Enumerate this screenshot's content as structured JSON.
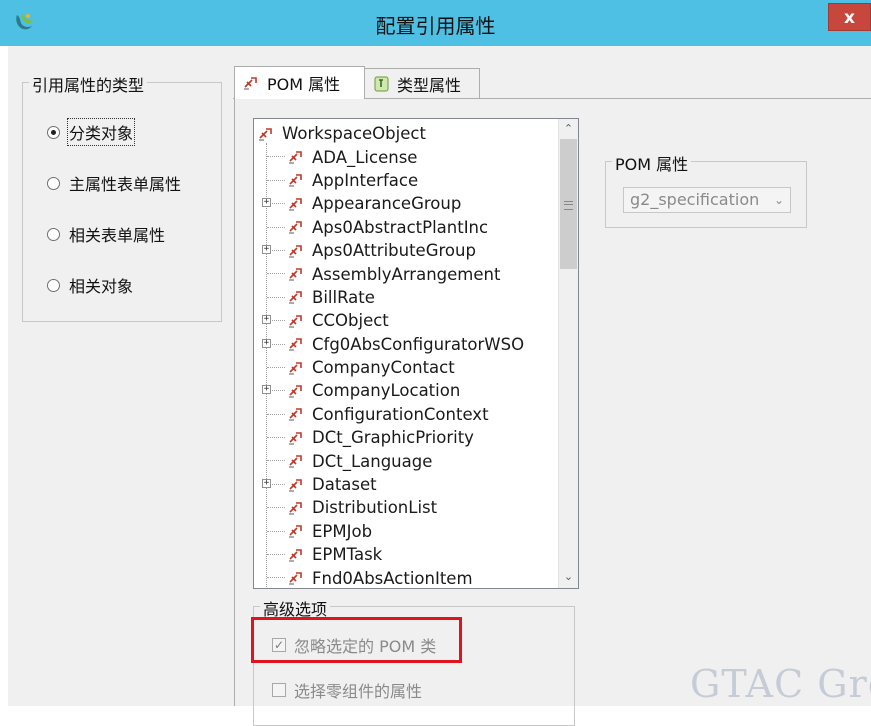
{
  "window": {
    "title": "配置引用属性",
    "close_label": "x",
    "icon": "app-logo-icon"
  },
  "reference_type": {
    "title": "引用属性的类型",
    "options": [
      {
        "label": "分类对象",
        "checked": true
      },
      {
        "label": "主属性表单属性",
        "checked": false
      },
      {
        "label": "相关表单属性",
        "checked": false
      },
      {
        "label": "相关对象",
        "checked": false
      }
    ]
  },
  "tabs": [
    {
      "label": "POM 属性",
      "active": true,
      "icon": "pom-class-icon"
    },
    {
      "label": "类型属性",
      "active": false,
      "icon": "type-attribute-icon"
    }
  ],
  "tree": {
    "root": "WorkspaceObject",
    "node_icon": "pom-class-icon",
    "items": [
      {
        "label": "ADA_License",
        "expandable": false
      },
      {
        "label": "AppInterface",
        "expandable": false
      },
      {
        "label": "AppearanceGroup",
        "expandable": true
      },
      {
        "label": "Aps0AbstractPlantInc",
        "expandable": false
      },
      {
        "label": "Aps0AttributeGroup",
        "expandable": true
      },
      {
        "label": "AssemblyArrangement",
        "expandable": false
      },
      {
        "label": "BillRate",
        "expandable": false
      },
      {
        "label": "CCObject",
        "expandable": true
      },
      {
        "label": "Cfg0AbsConfiguratorWSO",
        "expandable": true
      },
      {
        "label": "CompanyContact",
        "expandable": false
      },
      {
        "label": "CompanyLocation",
        "expandable": true
      },
      {
        "label": "ConfigurationContext",
        "expandable": false
      },
      {
        "label": "DCt_GraphicPriority",
        "expandable": false
      },
      {
        "label": "DCt_Language",
        "expandable": false
      },
      {
        "label": "Dataset",
        "expandable": true
      },
      {
        "label": "DistributionList",
        "expandable": false
      },
      {
        "label": "EPMJob",
        "expandable": false
      },
      {
        "label": "EPMTask",
        "expandable": false
      },
      {
        "label": "Fnd0AbsActionItem",
        "expandable": false
      }
    ]
  },
  "pom_property": {
    "title": "POM 属性",
    "selected": "g2_specification"
  },
  "advanced": {
    "title": "高级选项",
    "ignore_pom_class": {
      "label": "忽略选定的 POM 类",
      "checked": true
    },
    "select_component_props": {
      "label": "选择零组件的属性",
      "checked": false
    }
  },
  "watermark": "GTAC Gre",
  "colors": {
    "titlebar": "#4ec0e4",
    "close": "#c7473d",
    "highlight": "#e0141e"
  }
}
